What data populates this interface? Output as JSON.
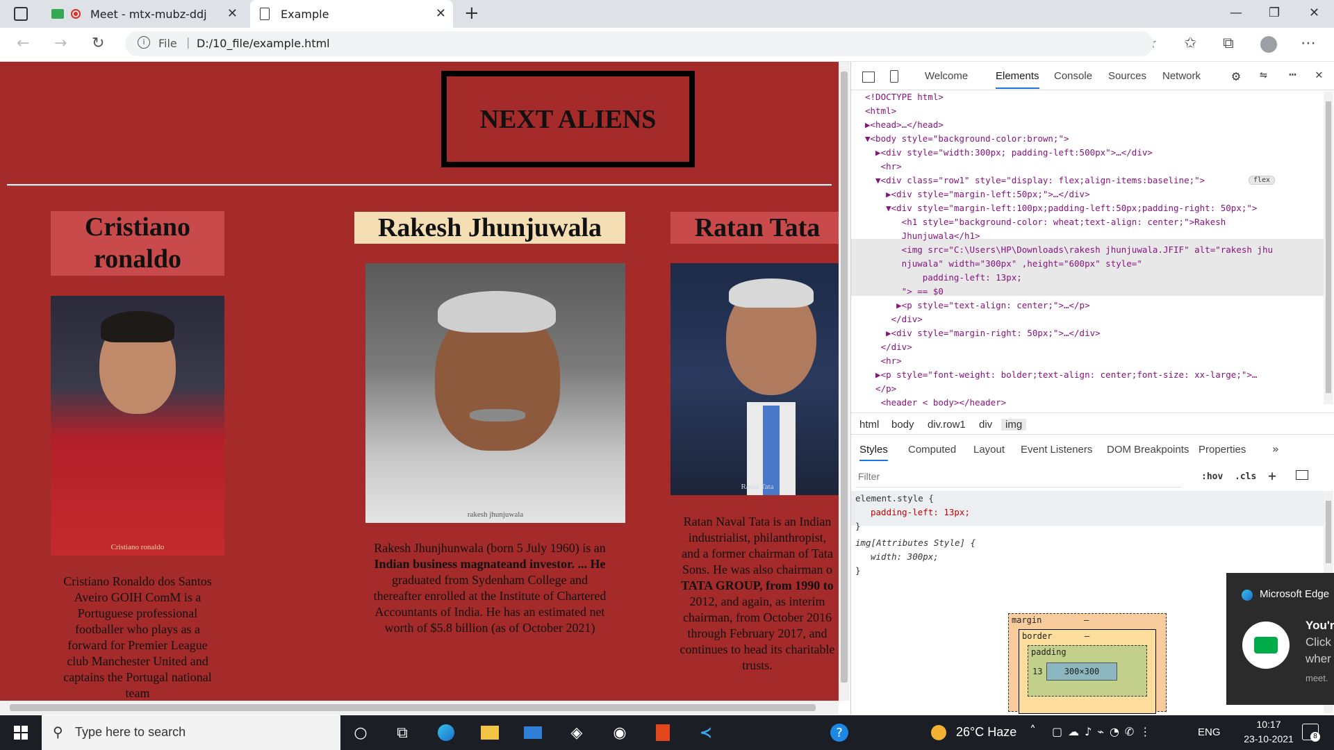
{
  "browser": {
    "tabs": [
      {
        "title": "Meet - mtx-mubz-ddj",
        "active": false
      },
      {
        "title": "Example",
        "active": true
      }
    ],
    "address": {
      "scheme_label": "File",
      "url": "D:/10_file/example.html"
    }
  },
  "page": {
    "heading": "NEXT ALIENS",
    "people": [
      {
        "name": "Cristiano ronaldo",
        "name_lines": [
          "Cristiano",
          "ronaldo"
        ],
        "photo_label": "Cristiano ronaldo",
        "bio_lines": [
          "Cristiano Ronaldo dos Santos",
          "Aveiro GOIH ComM is a",
          "Portuguese professional",
          "footballer who plays as a",
          "forward for Premier League",
          "club Manchester United and",
          "captains the Portugal national",
          "team"
        ]
      },
      {
        "name": "Rakesh Jhunjuwala",
        "photo_label": "rakesh jhunjuwala",
        "bio_lines": [
          "Rakesh Jhunjhunwala (born 5 July 1960) is an",
          "Indian business magnateand investor. ... He",
          "graduated from Sydenham College and",
          "thereafter enrolled at the Institute of Chartered",
          "Accountants of India. He has an estimated net",
          "worth of $5.8 billion (as of October 2021)"
        ]
      },
      {
        "name": "Ratan Tata",
        "photo_label": "Ratan Tata",
        "bio_lines": [
          "Ratan Naval Tata is an Indian",
          "industrialist, philanthropist,",
          "and a former chairman of Tata",
          "Sons. He was also chairman o",
          "TATA GROUP, from 1990 to",
          "2012, and again, as interim",
          "chairman, from October 2016",
          "through February 2017, and",
          "continues to head its charitable",
          "trusts."
        ]
      }
    ]
  },
  "devtools": {
    "tabs": [
      "Welcome",
      "Elements",
      "Console",
      "Sources",
      "Network"
    ],
    "active_tab": "Elements",
    "dom_lines": [
      "<!DOCTYPE html>",
      "<html>",
      "▶<head>…</head>",
      "▼<body style=\"background-color:brown;\">",
      "  ▶<div style=\"width:300px; padding-left:500px\">…</div>",
      "   <hr>",
      "  ▼<div class=\"row1\" style=\"display: flex;align-items:baseline;\">",
      "    ▶<div style=\"margin-left:50px;\">…</div>",
      "    ▼<div style=\"margin-left:100px;padding-left:50px;padding-right: 50px;\">",
      "       <h1 style=\"background-color: wheat;text-align: center;\">Rakesh",
      "       Jhunjuwala</h1>",
      "       <img src=\"C:\\Users\\HP\\Downloads\\rakesh jhunjuwala.JFIF\" alt=\"rakesh jhu",
      "       njuwala\" width=\"300px\" ,height=\"600px\" style=\"",
      "           padding-left: 13px;",
      "       \"> == $0",
      "      ▶<p style=\"text-align: center;\">…</p>",
      "     </div>",
      "    ▶<div style=\"margin-right: 50px;\">…</div>",
      "   </div>",
      "   <hr>",
      "  ▶<p style=\"font-weight: bolder;text-align: center;font-size: xx-large;\">…",
      "  </p>",
      "   <header < body></header>"
    ],
    "flex_badge": "flex",
    "breadcrumbs": [
      "html",
      "body",
      "div.row1",
      "div",
      "img"
    ],
    "sub_tabs": [
      "Styles",
      "Computed",
      "Layout",
      "Event Listeners",
      "DOM Breakpoints",
      "Properties"
    ],
    "filter_placeholder": "Filter",
    "hov": ":hov",
    "cls": ".cls",
    "styles": [
      {
        "selector": "element.style {",
        "prop": "padding-left: 13px;",
        "close": "}"
      },
      {
        "selector": "img[Attributes Style] {",
        "prop": "width: 300px;",
        "close": "}"
      }
    ],
    "box_model": {
      "margin": "margin",
      "border": "border",
      "padding": "padding",
      "padding_left": "13",
      "content": "300×300",
      "dash": "–"
    }
  },
  "notification": {
    "app": "Microsoft Edge",
    "line1": "You'r",
    "line2": "Click",
    "line3": "wher",
    "line4": "meet."
  },
  "taskbar": {
    "search_placeholder": "Type here to search",
    "weather": "26°C Haze",
    "lang": "ENG",
    "time": "10:17",
    "date": "23-10-2021",
    "notif_count": "8"
  },
  "colors": {
    "page_bg": "#a52a2a",
    "wheat": "#f5deb3",
    "name_bg": "#c94a4a",
    "taskbar": "#1b1e25"
  }
}
